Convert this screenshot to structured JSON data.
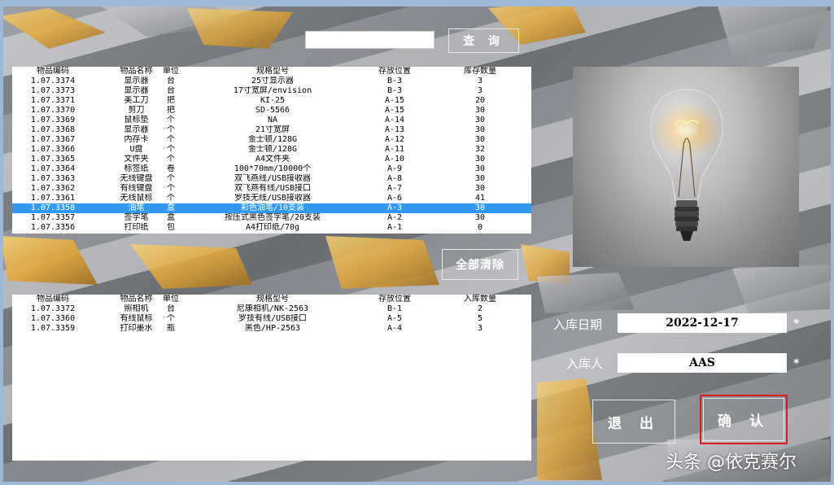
{
  "search": {
    "value": "",
    "button": "查 询"
  },
  "inventory": {
    "headers": [
      "物品编码",
      "物品名称",
      "单位",
      "规格型号",
      "存放位置",
      "库存数量"
    ],
    "rows": [
      [
        "1.07.3374",
        "显示器",
        "台",
        "25寸显示器",
        "B-3",
        "3"
      ],
      [
        "1.07.3373",
        "显示器",
        "台",
        "17寸宽屏/envision",
        "B-3",
        "3"
      ],
      [
        "1.07.3371",
        "美工刀",
        "把",
        "KI-25",
        "A-15",
        "20"
      ],
      [
        "1.07.3370",
        "剪刀",
        "把",
        "SD-5566",
        "A-15",
        "30"
      ],
      [
        "1.07.3369",
        "鼠标垫",
        "个",
        "NA",
        "A-14",
        "30"
      ],
      [
        "1.07.3368",
        "显示器",
        "个",
        "21寸宽屏",
        "A-13",
        "30"
      ],
      [
        "1.07.3367",
        "内存卡",
        "个",
        "金士顿/128G",
        "A-12",
        "30"
      ],
      [
        "1.07.3366",
        "U盘",
        "个",
        "金士顿/128G",
        "A-11",
        "32"
      ],
      [
        "1.07.3365",
        "文件夹",
        "个",
        "A4文件夹",
        "A-10",
        "30"
      ],
      [
        "1.07.3364",
        "标签纸",
        "卷",
        "100*70mm/10000个",
        "A-9",
        "30"
      ],
      [
        "1.07.3363",
        "无线键盘",
        "个",
        "双飞燕线/USB接收器",
        "A-8",
        "30"
      ],
      [
        "1.07.3362",
        "有线键盘",
        "个",
        "双飞燕有线/USB接口",
        "A-7",
        "30"
      ],
      [
        "1.07.3361",
        "无线鼠标",
        "个",
        "罗技无线/USB接收器",
        "A-6",
        "41"
      ],
      [
        "1.07.3358",
        "油笔",
        "盒",
        "彩色油笔/10支装",
        "A-3",
        "30"
      ],
      [
        "1.07.3357",
        "签字笔",
        "盒",
        "按压式黑色签字笔/20支装",
        "A-2",
        "30"
      ],
      [
        "1.07.3356",
        "打印纸",
        "包",
        "A4打印纸/70g",
        "A-1",
        "0"
      ]
    ],
    "selected_index": 13
  },
  "clear_button": "全部清除",
  "entry": {
    "headers": [
      "物品编码",
      "物品名称",
      "单位",
      "规格型号",
      "存放位置",
      "入库数量"
    ],
    "rows": [
      [
        "1.07.3372",
        "照相机",
        "台",
        "尼康相机/NK-2563",
        "B-1",
        "2"
      ],
      [
        "1.07.3360",
        "有线鼠标",
        "个",
        "罗技有线/USB接口",
        "A-5",
        "5"
      ],
      [
        "1.07.3359",
        "打印墨水",
        "瓶",
        "黑色/HP-2563",
        "A-4",
        "3"
      ]
    ]
  },
  "form": {
    "date_label": "入库日期",
    "date_value": "2022-12-17",
    "person_label": "入库人",
    "person_value": "AAS",
    "required_mark": "*"
  },
  "buttons": {
    "exit": "退 出",
    "confirm": "确 认"
  },
  "watermark": "头条 @依克赛尔",
  "colors": {
    "selection": "#3399ff",
    "confirm_border": "#d91d1d"
  }
}
